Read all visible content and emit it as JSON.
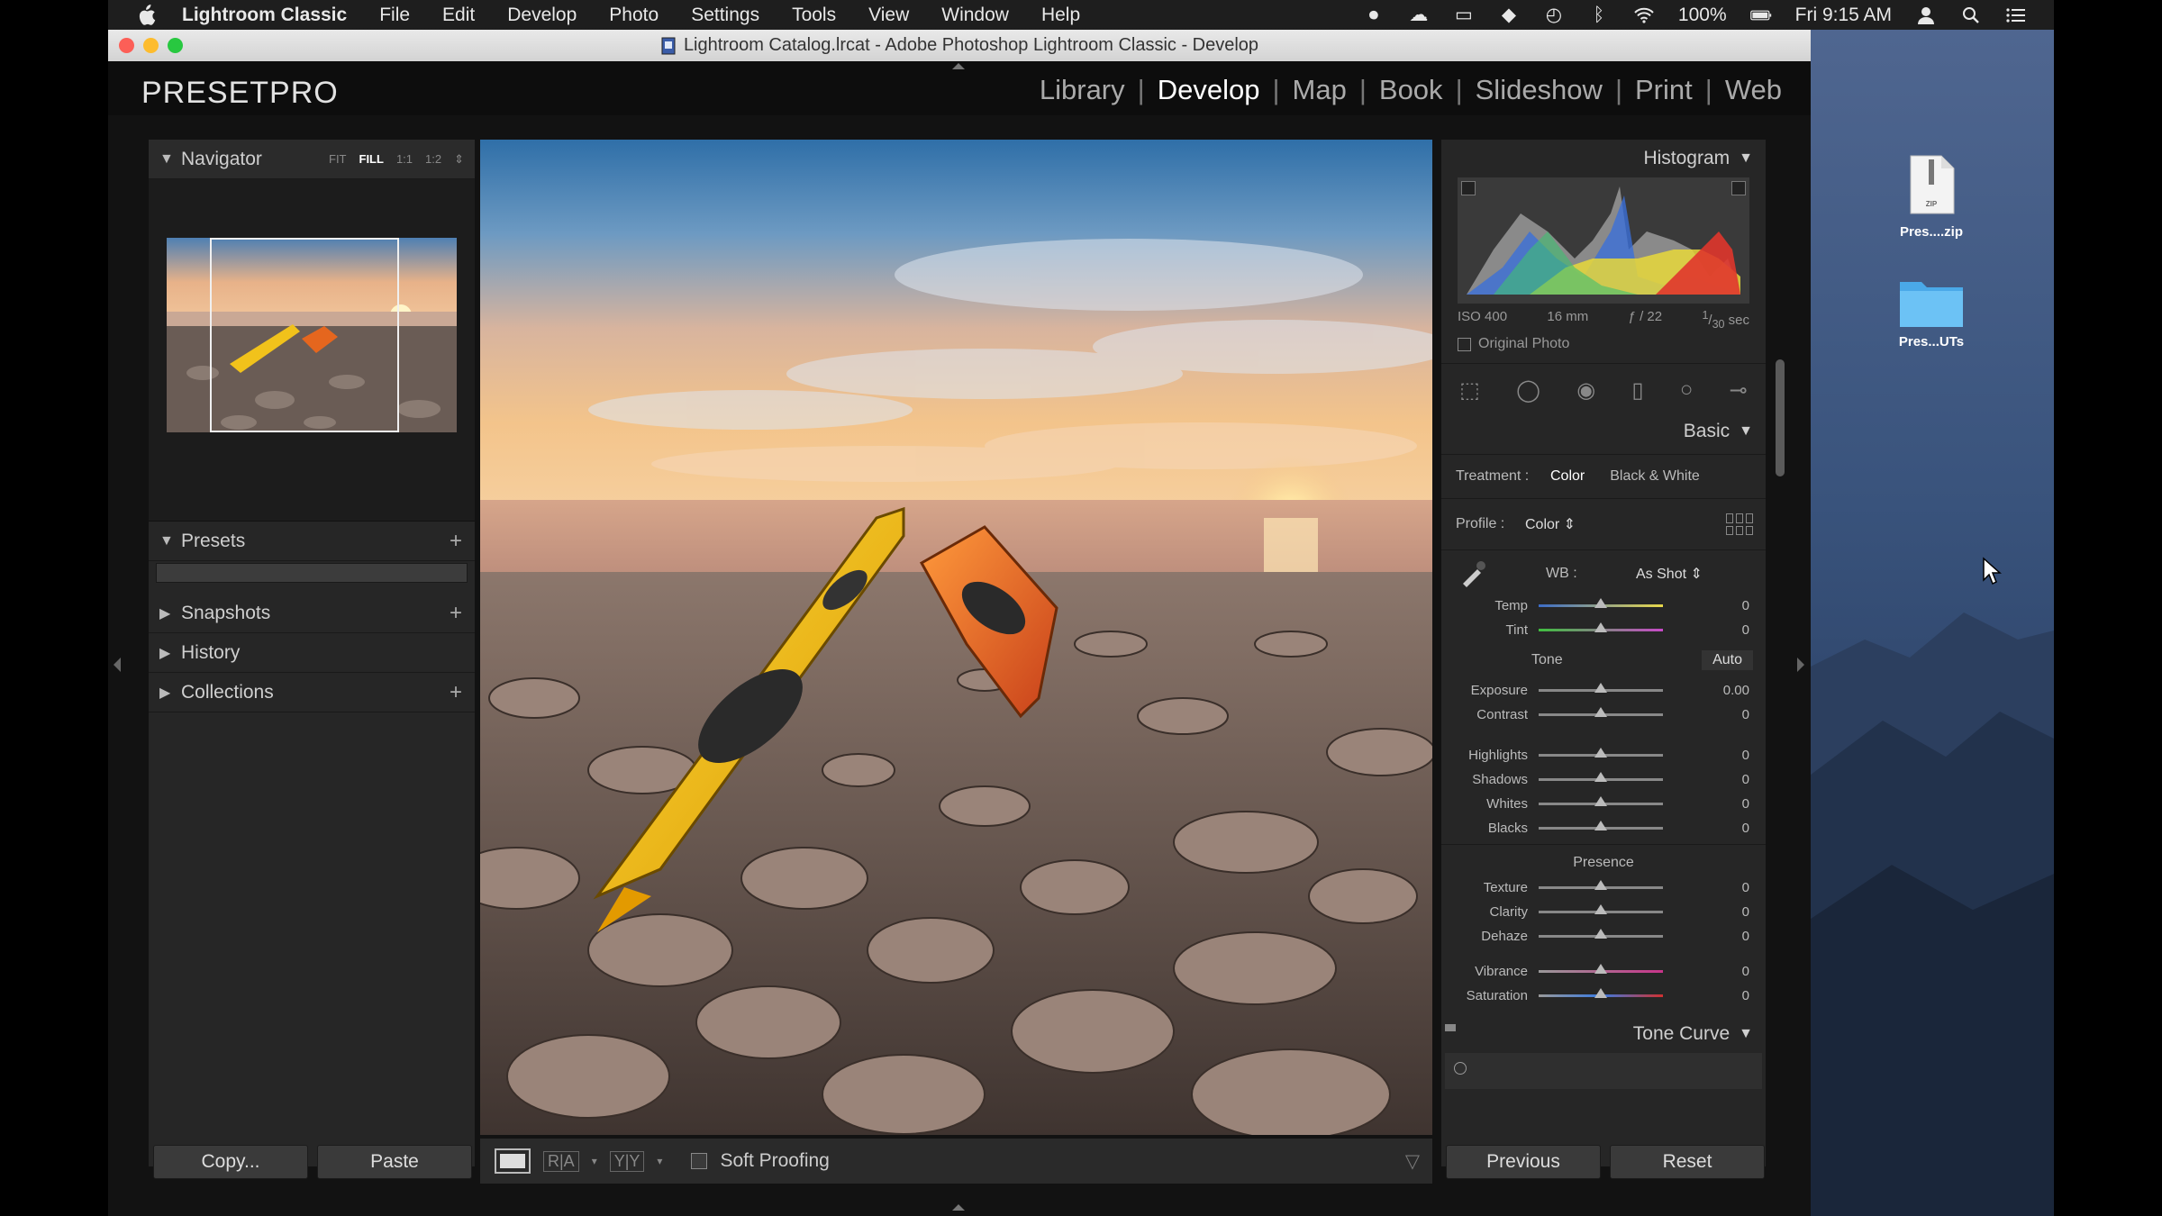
{
  "menubar": {
    "app_name": "Lightroom Classic",
    "items": [
      "File",
      "Edit",
      "Develop",
      "Photo",
      "Settings",
      "Tools",
      "View",
      "Window",
      "Help"
    ],
    "battery": "100%",
    "clock": "Fri 9:15 AM"
  },
  "window": {
    "title": "Lightroom Catalog.lrcat - Adobe Photoshop Lightroom Classic - Develop"
  },
  "header": {
    "brand": "PRESETPRO",
    "modules": [
      "Library",
      "Develop",
      "Map",
      "Book",
      "Slideshow",
      "Print",
      "Web"
    ],
    "active_module": "Develop"
  },
  "left_panel": {
    "navigator": {
      "label": "Navigator",
      "zoom_options": [
        "FIT",
        "FILL",
        "1:1",
        "1:2"
      ],
      "active_zoom": "FILL"
    },
    "presets_label": "Presets",
    "snapshots_label": "Snapshots",
    "history_label": "History",
    "collections_label": "Collections",
    "copy_button": "Copy...",
    "paste_button": "Paste"
  },
  "toolbar": {
    "soft_proofing_label": "Soft Proofing"
  },
  "right_panel": {
    "histogram_label": "Histogram",
    "exif": {
      "iso": "ISO 400",
      "focal": "16 mm",
      "aperture": "ƒ / 22",
      "shutter_num": "1",
      "shutter_den": "30",
      "shutter_unit": "sec"
    },
    "original_photo_label": "Original Photo",
    "basic_label": "Basic",
    "treatment_label": "Treatment :",
    "treatment_color": "Color",
    "treatment_bw": "Black & White",
    "profile_label": "Profile :",
    "profile_value": "Color",
    "wb_label": "WB :",
    "wb_value": "As Shot",
    "tone_label": "Tone",
    "auto_label": "Auto",
    "presence_label": "Presence",
    "sliders": {
      "temp": {
        "label": "Temp",
        "value": "0"
      },
      "tint": {
        "label": "Tint",
        "value": "0"
      },
      "exposure": {
        "label": "Exposure",
        "value": "0.00"
      },
      "contrast": {
        "label": "Contrast",
        "value": "0"
      },
      "highlights": {
        "label": "Highlights",
        "value": "0"
      },
      "shadows": {
        "label": "Shadows",
        "value": "0"
      },
      "whites": {
        "label": "Whites",
        "value": "0"
      },
      "blacks": {
        "label": "Blacks",
        "value": "0"
      },
      "texture": {
        "label": "Texture",
        "value": "0"
      },
      "clarity": {
        "label": "Clarity",
        "value": "0"
      },
      "dehaze": {
        "label": "Dehaze",
        "value": "0"
      },
      "vibrance": {
        "label": "Vibrance",
        "value": "0"
      },
      "saturation": {
        "label": "Saturation",
        "value": "0"
      }
    },
    "tone_curve_label": "Tone Curve",
    "previous_button": "Previous",
    "reset_button": "Reset"
  },
  "desktop": {
    "icon1_label": "Pres....zip",
    "icon2_label": "Pres...UTs"
  }
}
